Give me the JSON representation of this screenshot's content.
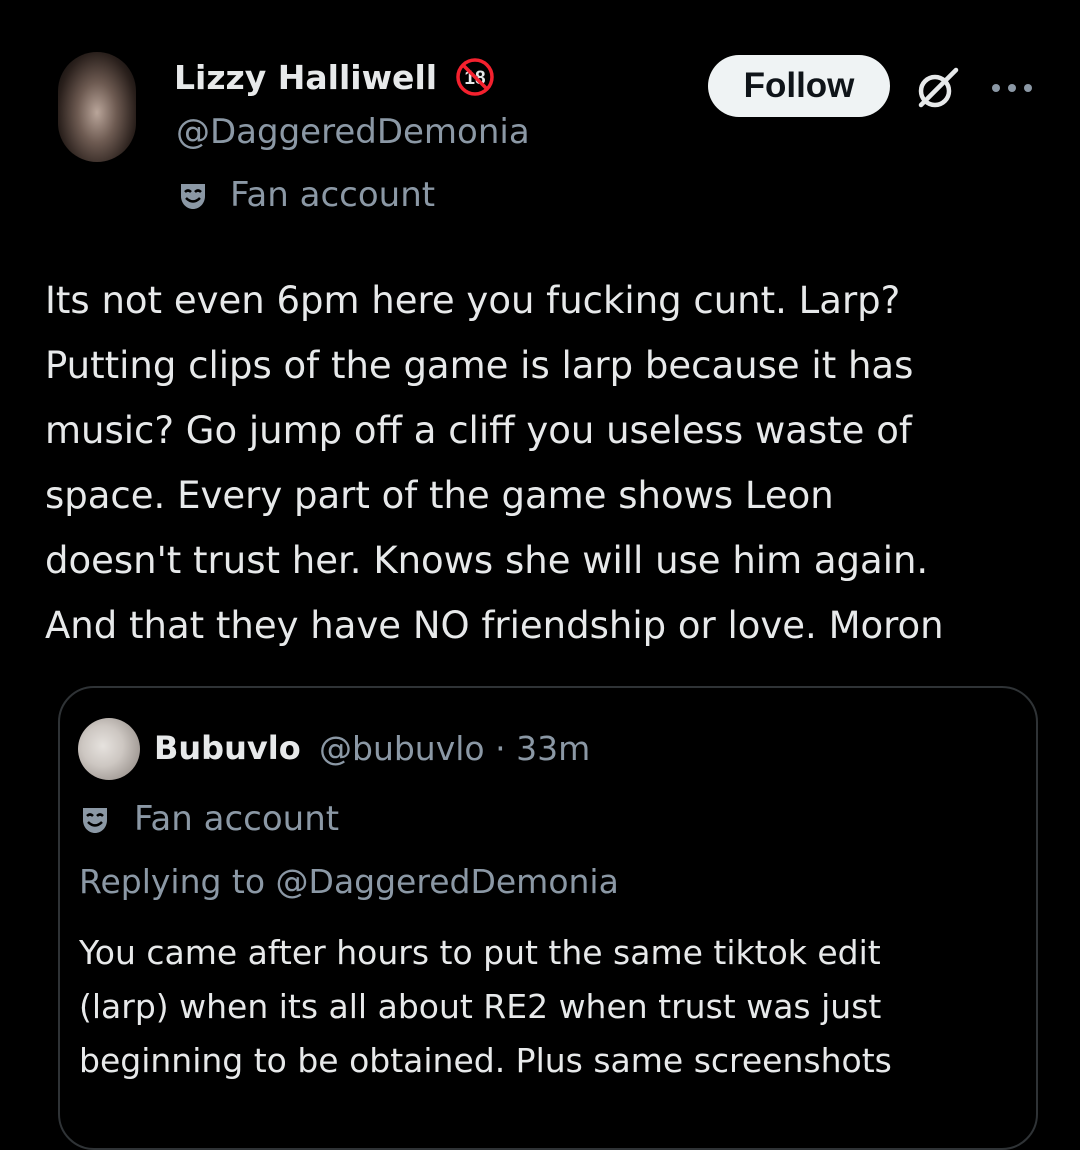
{
  "tweet": {
    "author": {
      "name": "Lizzy Halliwell",
      "age_badge": "18",
      "handle": "@DaggeredDemonia",
      "label": "Fan account"
    },
    "actions": {
      "follow_label": "Follow",
      "grok_icon": "grok-icon",
      "more_icon": "more-icon"
    },
    "text": "Its not even 6pm here you fucking cunt. Larp?\nPutting clips of the game is larp because it has\nmusic? Go jump off a cliff you useless waste of\nspace. Every part of the game shows Leon\ndoesn't trust her. Knows she will use him again.\nAnd that they have NO friendship or love. Moron"
  },
  "quote": {
    "author": {
      "name": "Bubuvlo",
      "handle_time": "@bubuvlo · 33m",
      "label": "Fan account"
    },
    "replying": "Replying to @DaggeredDemonia",
    "text": "You came after hours to put the same tiktok edit\n(larp) when its all about RE2 when trust was just\nbeginning to be obtained. Plus same screenshots"
  },
  "colors": {
    "background": "#000000",
    "text_primary": "#e7e9ea",
    "text_secondary": "#8b98a5",
    "follow_bg": "#eff3f4",
    "badge_red": "#f4212e",
    "card_border": "#2f3336"
  }
}
